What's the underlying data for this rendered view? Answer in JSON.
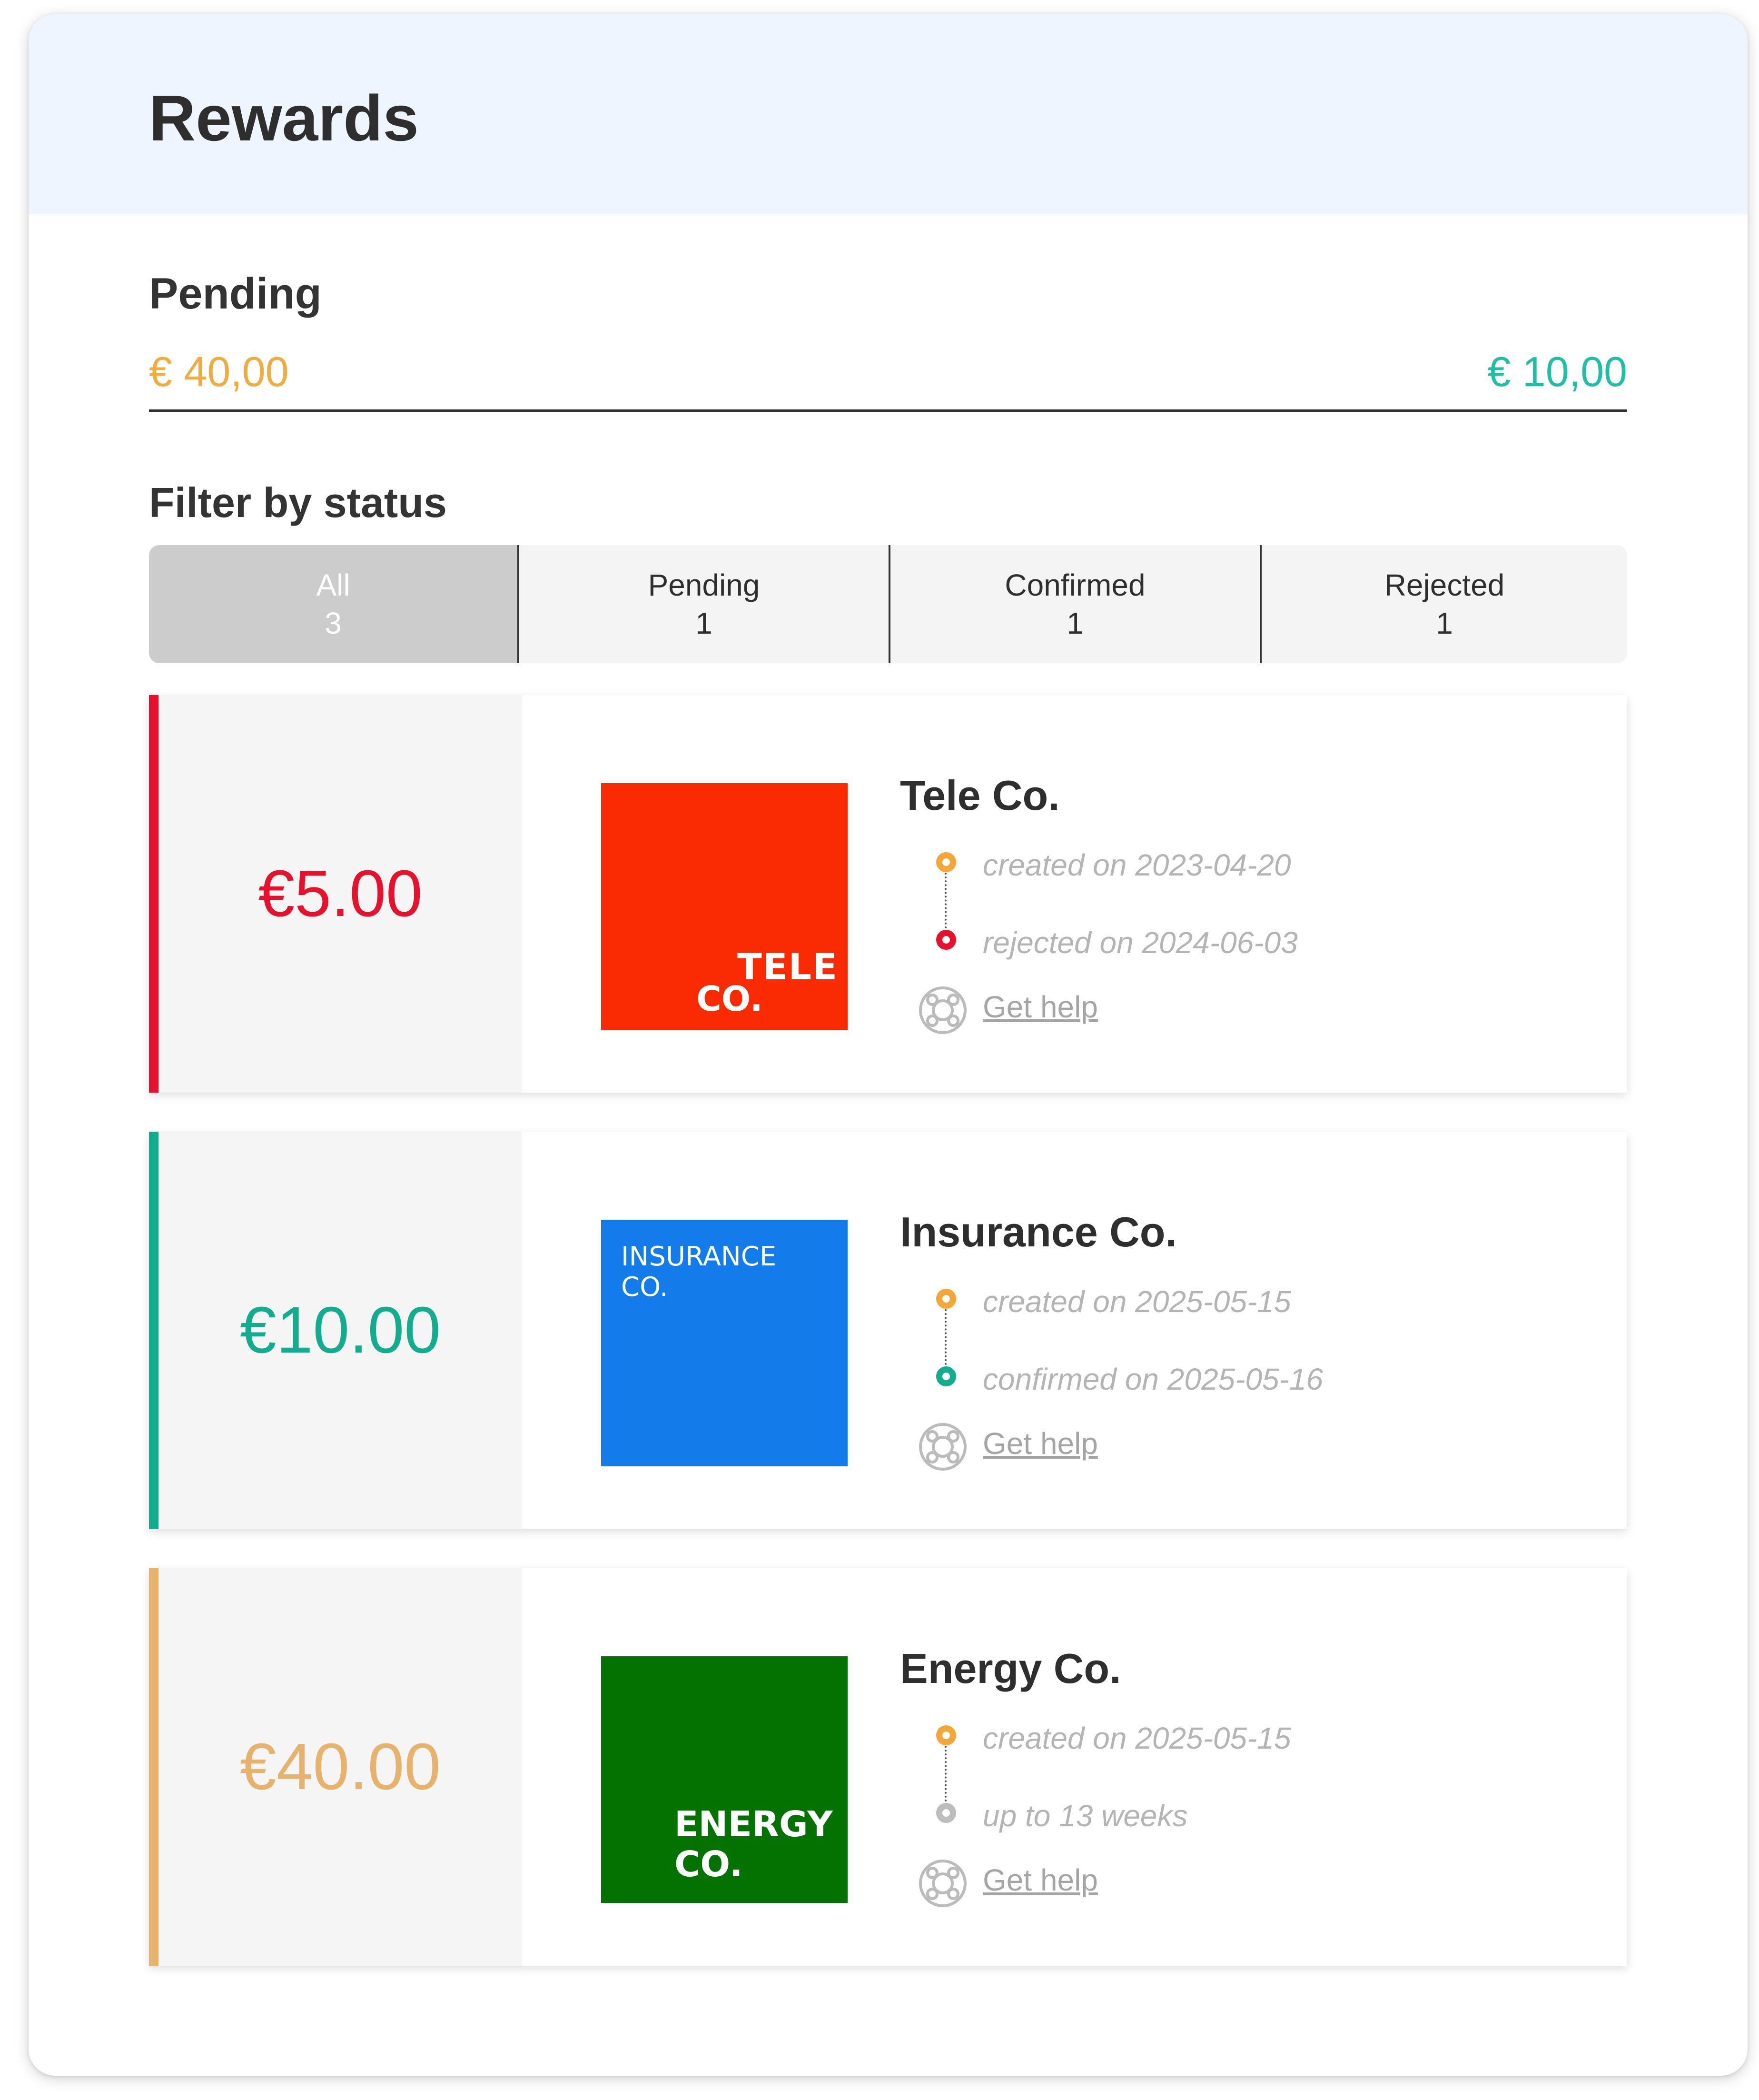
{
  "header": {
    "title": "Rewards"
  },
  "summary": {
    "pending_label": "Pending",
    "pending_amount": "€ 40,00",
    "confirmed_amount": "€ 10,00"
  },
  "filter": {
    "label": "Filter by status",
    "tabs": [
      {
        "label": "All",
        "count": "3",
        "active": true
      },
      {
        "label": "Pending",
        "count": "1",
        "active": false
      },
      {
        "label": "Confirmed",
        "count": "1",
        "active": false
      },
      {
        "label": "Rejected",
        "count": "1",
        "active": false
      }
    ]
  },
  "rewards": [
    {
      "amount": "€5.00",
      "status": "rejected",
      "accent_color": "#e8112d",
      "company": "Tele Co.",
      "logo_text": [
        "TELE",
        "CO."
      ],
      "logo_color": "#fa2a02",
      "timeline": [
        {
          "text": "created on 2023-04-20",
          "dot_color": "#f5a638"
        },
        {
          "text": "rejected on 2024-06-03",
          "dot_color": "#e8112d"
        }
      ],
      "help_label": "Get help"
    },
    {
      "amount": "€10.00",
      "status": "confirmed",
      "accent_color": "#12ad8e",
      "company": "Insurance Co.",
      "logo_text": [
        "INSURANCE",
        "CO."
      ],
      "logo_color": "#137cea",
      "timeline": [
        {
          "text": "created on 2025-05-15",
          "dot_color": "#f5a638"
        },
        {
          "text": "confirmed on 2025-05-16",
          "dot_color": "#12ad8e"
        }
      ],
      "help_label": "Get help"
    },
    {
      "amount": "€40.00",
      "status": "pending",
      "accent_color": "#e7b26b",
      "company": "Energy Co.",
      "logo_text": [
        "ENERGY",
        "CO."
      ],
      "logo_color": "#047200",
      "timeline": [
        {
          "text": "created on 2025-05-15",
          "dot_color": "#f5a638"
        },
        {
          "text": "up to 13 weeks",
          "dot_color": "#bdbdbd"
        }
      ],
      "help_label": "Get help"
    }
  ]
}
